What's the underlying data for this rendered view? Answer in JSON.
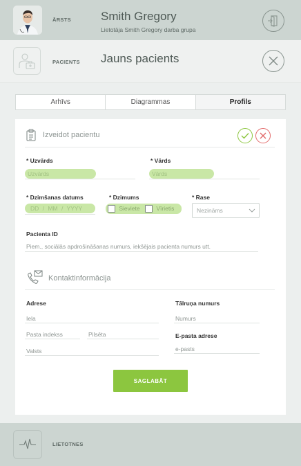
{
  "doctor": {
    "role_label": "ĀRSTS",
    "name": "Smith Gregory",
    "group": "Lietotāja Smith Gregory darba grupa",
    "logout_icon": "logout-door-icon"
  },
  "patient_header": {
    "label": "PACIENTS",
    "title": "Jauns pacients",
    "close_icon": "close-icon"
  },
  "tabs": [
    {
      "label": "Arhīvs",
      "active": false
    },
    {
      "label": "Diagrammas",
      "active": false
    },
    {
      "label": "Profils",
      "active": true
    }
  ],
  "create_section": {
    "title": "Izveidot pacientu",
    "confirm_icon": "check-icon",
    "cancel_icon": "cancel-icon"
  },
  "fields": {
    "surname": {
      "label": "* Uzvārds",
      "placeholder": "Uzvārds"
    },
    "name": {
      "label": "* Vārds",
      "placeholder": "Vārds"
    },
    "birth_date": {
      "label": "* Dzimšanas datums",
      "dd": "DD",
      "mm": "MM",
      "yyyy": "YYYY",
      "sep": "/"
    },
    "gender": {
      "label": "* Dzimums",
      "options": [
        "Sieviete",
        "Vīrietis"
      ]
    },
    "race": {
      "label": "* Rase",
      "value": "Nezināms"
    },
    "patient_id": {
      "label": "Pacienta ID",
      "placeholder": "Piem., sociālās apdrošināšanas numurs, iekšējais pacienta numurs utt."
    }
  },
  "contact_section": {
    "title": "Kontaktinformācija",
    "address_label": "Adrese",
    "street_placeholder": "Iela",
    "postcode_placeholder": "Pasta indekss",
    "city_placeholder": "Pilsēta",
    "country_placeholder": "Valsts",
    "phone_label": "Tālruņa numurs",
    "phone_placeholder": "Numurs",
    "email_label": "E-pasta adrese",
    "email_placeholder": "e-pasts"
  },
  "save_button": "SAGLABĀT",
  "settings": {
    "label": "LIETOTNES"
  },
  "colors": {
    "accent_green": "#8cc63f",
    "cancel_red": "#e26a6a",
    "header_bg": "#ccd5d1"
  }
}
